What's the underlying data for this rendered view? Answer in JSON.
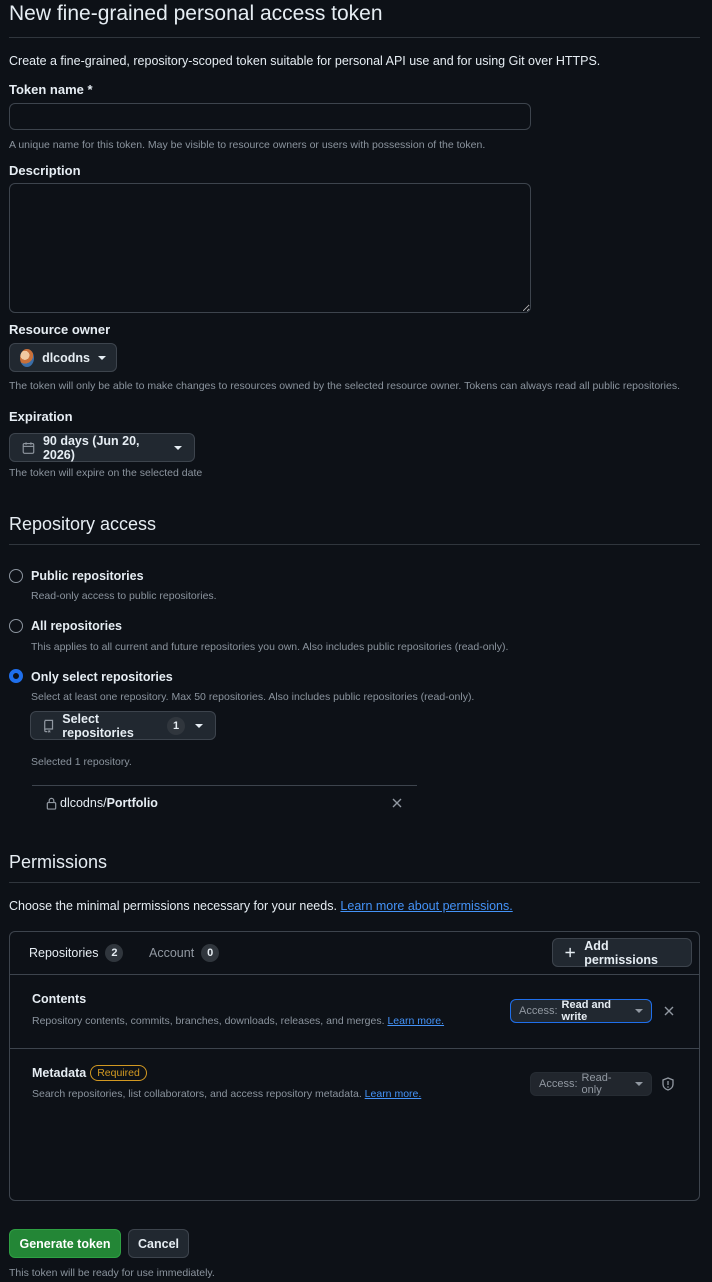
{
  "page": {
    "title": "New fine-grained personal access token",
    "intro": "Create a fine-grained, repository-scoped token suitable for personal API use and for using Git over HTTPS."
  },
  "token_name": {
    "label": "Token name *",
    "value": "",
    "note": "A unique name for this token. May be visible to resource owners or users with possession of the token."
  },
  "description": {
    "label": "Description",
    "value": ""
  },
  "resource_owner": {
    "label": "Resource owner",
    "value": "dlcodns",
    "note": "The token will only be able to make changes to resources owned by the selected resource owner. Tokens can always read all public repositories."
  },
  "expiration": {
    "label": "Expiration",
    "value": "90 days (Jun 20, 2026)",
    "note": "The token will expire on the selected date"
  },
  "repository_access": {
    "heading": "Repository access",
    "options": [
      {
        "label": "Public repositories",
        "desc": "Read-only access to public repositories.",
        "selected": false
      },
      {
        "label": "All repositories",
        "desc": "This applies to all current and future repositories you own. Also includes public repositories (read-only).",
        "selected": false
      },
      {
        "label": "Only select repositories",
        "desc": "Select at least one repository. Max 50 repositories. Also includes public repositories (read-only).",
        "selected": true
      }
    ],
    "select_button": "Select repositories",
    "select_count": "1",
    "selected_note": "Selected 1 repository.",
    "repo_owner": "dlcodns/",
    "repo_name": "Portfolio"
  },
  "permissions": {
    "heading": "Permissions",
    "intro": "Choose the minimal permissions necessary for your needs.",
    "intro_link": "Learn more about permissions.",
    "tabs": [
      {
        "label": "Repositories",
        "count": "2"
      },
      {
        "label": "Account",
        "count": "0"
      }
    ],
    "add_button": "Add permissions",
    "rows": [
      {
        "name": "Contents",
        "badge": "",
        "desc": "Repository contents, commits, branches, downloads, releases, and merges.",
        "link": "Learn more.",
        "access_prefix": "Access:",
        "access_value": "Read and write"
      },
      {
        "name": "Metadata",
        "badge": "Required",
        "desc": "Search repositories, list collaborators, and access repository metadata.",
        "link": "Learn more.",
        "access_prefix": "Access:",
        "access_value": "Read-only"
      }
    ]
  },
  "footer": {
    "generate": "Generate token",
    "cancel": "Cancel",
    "note": "This token will be ready for use immediately."
  },
  "colors": {
    "background": "#0d1117",
    "primary_button": "#238636",
    "accent": "#1f6feb",
    "link": "#4493f8",
    "required_badge": "#d29922"
  }
}
